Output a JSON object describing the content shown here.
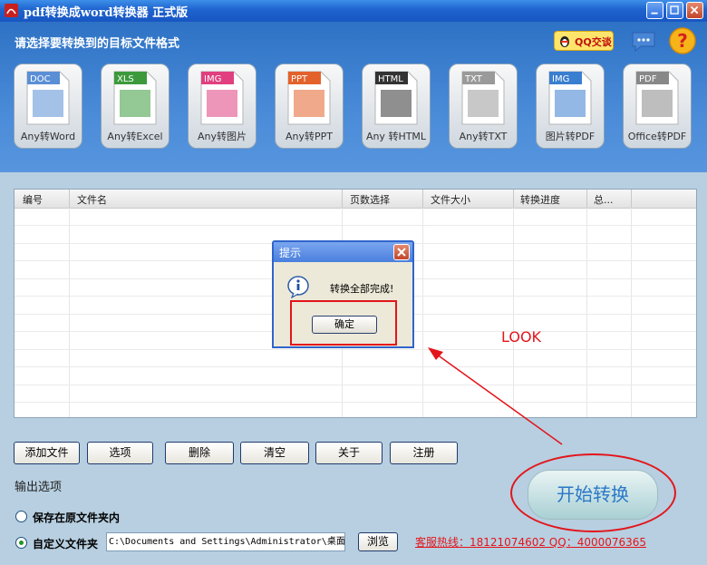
{
  "window": {
    "title": "pdf转换成word转换器 正式版"
  },
  "header": {
    "select_label": "请选择要转换到的目标文件格式",
    "qq_label": "QQ交谈"
  },
  "formats": [
    {
      "tag": "DOC",
      "label": "Any转Word",
      "color": "#5a8fd6"
    },
    {
      "tag": "XLS",
      "label": "Any转Excel",
      "color": "#3c9a3c"
    },
    {
      "tag": "IMG",
      "label": "Any转图片",
      "color": "#e0407f"
    },
    {
      "tag": "PPT",
      "label": "Any转PPT",
      "color": "#e3622b"
    },
    {
      "tag": "HTML",
      "label": "Any 转HTML",
      "color": "#333333"
    },
    {
      "tag": "TXT",
      "label": "Any转TXT",
      "color": "#9a9a9a"
    },
    {
      "tag": "IMG",
      "label": "图片转PDF",
      "color": "#3a7ed0"
    },
    {
      "tag": "PDF",
      "label": "Office转PDF",
      "color": "#888888"
    }
  ],
  "table": {
    "columns": [
      "编号",
      "文件名",
      "页数选择",
      "文件大小",
      "转换进度",
      "总..."
    ]
  },
  "dialog": {
    "title": "提示",
    "message": "转换全部完成!",
    "ok_label": "确定"
  },
  "annotation": {
    "look_label": "LOOK"
  },
  "buttons": {
    "add_file": "添加文件",
    "options": "选项",
    "delete": "删除",
    "clear": "清空",
    "about": "关于",
    "register": "注册",
    "start": "开始转换",
    "browse": "浏览"
  },
  "output": {
    "section_label": "输出选项",
    "option_original": "保存在原文件夹内",
    "option_custom": "自定义文件夹",
    "selected": "custom",
    "path_value": "C:\\Documents and Settings\\Administrator\\桌面"
  },
  "hotline": "客服热线：18121074602 QQ：4000076365",
  "colors": {
    "accent_red": "#e3151b",
    "title_blue": "#1e63cf",
    "start_text": "#2a78c8"
  }
}
